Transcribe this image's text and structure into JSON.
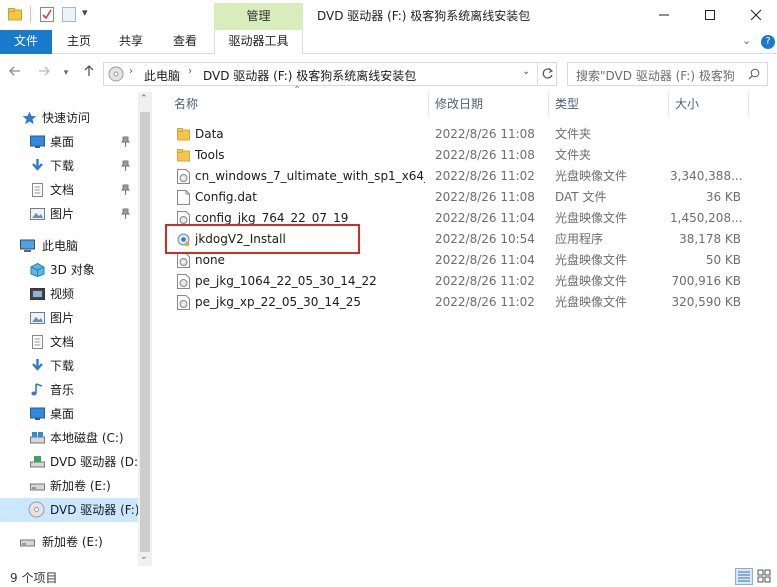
{
  "window": {
    "title": "DVD 驱动器 (F:) 极客狗系统离线安装包",
    "context_tab_group": "管理",
    "controls": [
      "minimize",
      "maximize",
      "close"
    ]
  },
  "ribbon": {
    "tabs": [
      "文件",
      "主页",
      "共享",
      "查看",
      "驱动器工具"
    ],
    "selected_tab": "驱动器工具"
  },
  "navigation": {
    "back_icon": "arrow-left-icon",
    "forward_icon": "arrow-right-icon",
    "recent_icon": "chevron-down-icon",
    "up_icon": "arrow-up-icon",
    "breadcrumb": [
      "此电脑",
      "DVD 驱动器 (F:) 极客狗系统离线安装包"
    ],
    "search_placeholder": "搜索\"DVD 驱动器 (F:) 极客狗..."
  },
  "sidebar": {
    "quick_access_label": "快速访问",
    "quick_access_items": [
      {
        "label": "桌面",
        "icon": "desktop-icon",
        "pinned": true
      },
      {
        "label": "下载",
        "icon": "download-icon",
        "pinned": true
      },
      {
        "label": "文档",
        "icon": "document-icon",
        "pinned": true
      },
      {
        "label": "图片",
        "icon": "pictures-icon",
        "pinned": true
      }
    ],
    "this_pc_label": "此电脑",
    "this_pc_items": [
      {
        "label": "3D 对象",
        "icon": "3d-objects-icon"
      },
      {
        "label": "视频",
        "icon": "video-icon"
      },
      {
        "label": "图片",
        "icon": "pictures-icon"
      },
      {
        "label": "文档",
        "icon": "document-icon"
      },
      {
        "label": "下载",
        "icon": "download-icon"
      },
      {
        "label": "音乐",
        "icon": "music-icon"
      },
      {
        "label": "桌面",
        "icon": "desktop-icon"
      },
      {
        "label": "本地磁盘 (C:)",
        "icon": "local-disk-icon"
      },
      {
        "label": "DVD 驱动器 (D:",
        "icon": "dvd-drive-icon"
      },
      {
        "label": "新加卷 (E:)",
        "icon": "drive-icon"
      },
      {
        "label": "DVD 驱动器 (F:)",
        "icon": "dvd-drive-icon",
        "selected": true
      }
    ],
    "network_items": [
      {
        "label": "新加卷 (E:)",
        "icon": "drive-icon"
      }
    ]
  },
  "file_list": {
    "columns": [
      "名称",
      "修改日期",
      "类型",
      "大小"
    ],
    "rows": [
      {
        "name": "Data",
        "date": "2022/8/26 11:08",
        "type": "文件夹",
        "size": "",
        "icon": "folder-icon"
      },
      {
        "name": "Tools",
        "date": "2022/8/26 11:08",
        "type": "文件夹",
        "size": "",
        "icon": "folder-icon"
      },
      {
        "name": "cn_windows_7_ultimate_with_sp1_x64_...",
        "date": "2022/8/26 11:02",
        "type": "光盘映像文件",
        "size": "3,340,388...",
        "icon": "disc-image-icon"
      },
      {
        "name": "Config.dat",
        "date": "2022/8/26 11:08",
        "type": "DAT 文件",
        "size": "36 KB",
        "icon": "file-icon"
      },
      {
        "name": "config_jkg_764_22_07_19",
        "date": "2022/8/26 11:04",
        "type": "光盘映像文件",
        "size": "1,450,208...",
        "icon": "disc-image-icon"
      },
      {
        "name": "jkdogV2_Install",
        "date": "2022/8/26 10:54",
        "type": "应用程序",
        "size": "38,178 KB",
        "icon": "application-icon",
        "highlighted": true
      },
      {
        "name": "none",
        "date": "2022/8/26 11:04",
        "type": "光盘映像文件",
        "size": "50 KB",
        "icon": "disc-image-icon"
      },
      {
        "name": "pe_jkg_1064_22_05_30_14_22",
        "date": "2022/8/26 11:02",
        "type": "光盘映像文件",
        "size": "700,916 KB",
        "icon": "disc-image-icon"
      },
      {
        "name": "pe_jkg_xp_22_05_30_14_25",
        "date": "2022/8/26 11:02",
        "type": "光盘映像文件",
        "size": "320,590 KB",
        "icon": "disc-image-icon"
      }
    ]
  },
  "status_bar": {
    "item_count": "9 个项目"
  },
  "colors": {
    "accent": "#1979ca",
    "context_tab": "#d7eebc",
    "highlight_border": "#d02b2b",
    "folder": "#f3c64a",
    "selected_row": "#cce8ff"
  }
}
